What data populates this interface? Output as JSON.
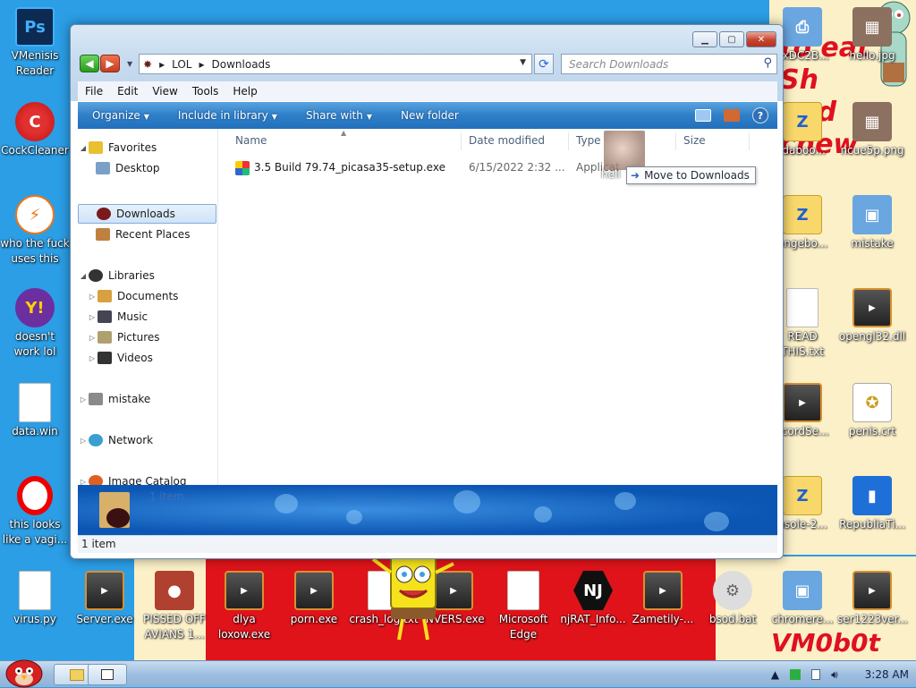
{
  "desktop": {
    "wallpaper_text": "to eat Sh... and chew",
    "watermark": "VM0b0t",
    "icons_left": [
      {
        "label": "VMenisis\nReader",
        "icon": "photoshop-icon"
      },
      {
        "label": "CockCleaner",
        "icon": "ccleaner-icon"
      },
      {
        "label": "who the fuck\nuses this",
        "icon": "bolt-icon"
      },
      {
        "label": "doesn't\nwork lol",
        "icon": "yahoo-messenger-icon"
      },
      {
        "label": "data.win",
        "icon": "document-icon"
      },
      {
        "label": "this looks\nlike a vagi...",
        "icon": "opera-icon"
      }
    ],
    "icons_bottom": [
      {
        "label": "virus.py",
        "icon": "document-icon"
      },
      {
        "label": "Server.exe",
        "icon": "exe-icon"
      },
      {
        "label": "PISSED OFF\nAVIANS 1...",
        "icon": "angry-birds-icon"
      },
      {
        "label": "dlya\nloxow.exe",
        "icon": "exe-icon"
      },
      {
        "label": "porn.exe",
        "icon": "exe-icon"
      },
      {
        "label": "crash_log.txt",
        "icon": "text-file-icon"
      },
      {
        "label": "INVERS.exe",
        "icon": "exe-icon"
      },
      {
        "label": "Microsoft\nEdge",
        "icon": "document-icon"
      },
      {
        "label": "njRAT_Info...",
        "icon": "njrat-icon"
      },
      {
        "label": "Zametily-...",
        "icon": "exe-icon"
      },
      {
        "label": "bsod.bat",
        "icon": "gear-icon"
      },
      {
        "label": "chromere...",
        "icon": "computer-icon"
      },
      {
        "label": "ser1223ver...",
        "icon": "exe-icon"
      }
    ],
    "icons_right": [
      {
        "label": "exDC2B...",
        "icon": "printer-icon"
      },
      {
        "label": "hello.jpg",
        "icon": "photo-icon"
      },
      {
        "label": "ldaboo...",
        "icon": "folder-zip-icon"
      },
      {
        "label": "ncue5p.png",
        "icon": "photo-icon"
      },
      {
        "label": "ongebo...",
        "icon": "folder-zip-icon"
      },
      {
        "label": "mistake",
        "icon": "computer-icon"
      },
      {
        "label": "READ\nTHIS.txt",
        "icon": "text-file-icon"
      },
      {
        "label": "opengl32.dll",
        "icon": "exe-icon"
      },
      {
        "label": "scordSe...",
        "icon": "exe-icon"
      },
      {
        "label": "penis.crt",
        "icon": "certificate-icon"
      },
      {
        "label": "nsole-2...",
        "icon": "folder-zip-icon"
      },
      {
        "label": "RepubliaTi...",
        "icon": "book-icon"
      }
    ]
  },
  "explorer": {
    "breadcrumb": [
      "LOL",
      "Downloads"
    ],
    "search_placeholder": "Search Downloads",
    "menu": [
      "File",
      "Edit",
      "View",
      "Tools",
      "Help"
    ],
    "toolbar": {
      "organize": "Organize",
      "include": "Include in library",
      "share": "Share with",
      "new_folder": "New folder"
    },
    "nav": {
      "favorites": "Favorites",
      "desktop": "Desktop",
      "downloads": "Downloads",
      "recent": "Recent Places",
      "libraries": "Libraries",
      "documents": "Documents",
      "music": "Music",
      "pictures": "Pictures",
      "videos": "Videos",
      "mistake": "mistake",
      "network": "Network",
      "image_catalog": "Image Catalog"
    },
    "columns": {
      "name": "Name",
      "date": "Date modified",
      "type": "Type",
      "size": "Size"
    },
    "files": [
      {
        "name": "3.5 Build 79.74_picasa35-setup.exe",
        "date": "6/15/2022 2:32 ...",
        "type": "Applicat"
      }
    ],
    "drag": {
      "caption": "hell",
      "tooltip": "Move to Downloads"
    },
    "details_count": "1 item",
    "status": "1 item"
  },
  "taskbar": {
    "clock": "3:28 AM"
  }
}
